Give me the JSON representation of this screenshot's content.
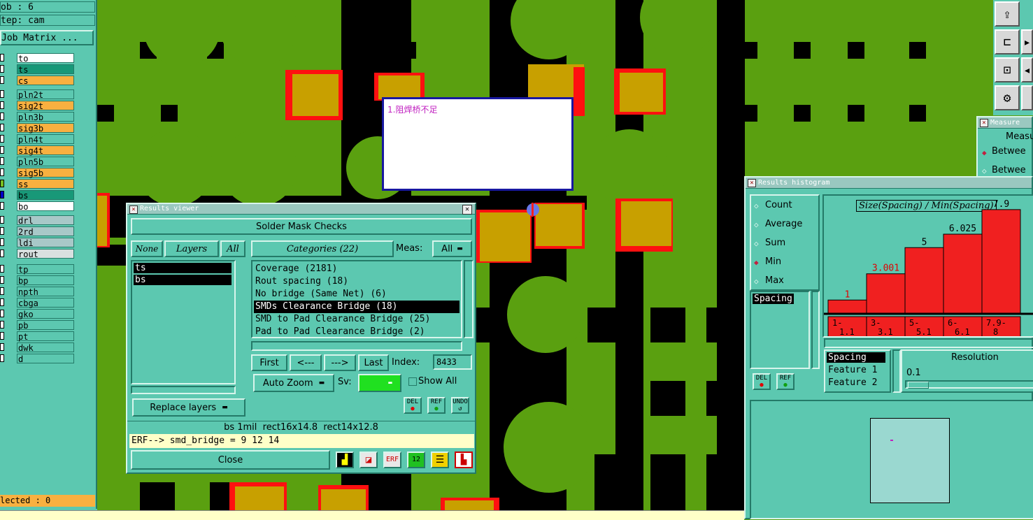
{
  "left_panel": {
    "job_label": "ob  : 6",
    "step_label": "tep: cam",
    "matrix_button": "Job Matrix ...",
    "layers": [
      {
        "name": "to",
        "color": "#ffffff",
        "sq": "#ffffff"
      },
      {
        "name": "ts",
        "color": "#189878",
        "sq": "#ffffff"
      },
      {
        "name": "cs",
        "color": "#f8b040",
        "sq": "#ffffff"
      },
      {
        "name": "pln2t",
        "color": "#5cc8b0",
        "sq": "#ffffff"
      },
      {
        "name": "sig2t",
        "color": "#f8b040",
        "sq": "#ffffff"
      },
      {
        "name": "pln3b",
        "color": "#5cc8b0",
        "sq": "#ffffff"
      },
      {
        "name": "sig3b",
        "color": "#f8b040",
        "sq": "#ffffff"
      },
      {
        "name": "pln4t",
        "color": "#5cc8b0",
        "sq": "#ffffff"
      },
      {
        "name": "sig4t",
        "color": "#f8b040",
        "sq": "#ffffff"
      },
      {
        "name": "pln5b",
        "color": "#5cc8b0",
        "sq": "#ffffff"
      },
      {
        "name": "sig5b",
        "color": "#f8b040",
        "sq": "#ffffff"
      },
      {
        "name": "ss",
        "color": "#f8b040",
        "sq": "#78c020"
      },
      {
        "name": "bs",
        "color": "#189878",
        "sq": "#0000c8"
      },
      {
        "name": "bo",
        "color": "#ffffff",
        "sq": "#ffffff"
      },
      {
        "name": "drl",
        "color": "#a8c8c8",
        "sq": "#ffffff"
      },
      {
        "name": "2rd",
        "color": "#a8c8c8",
        "sq": "#ffffff"
      },
      {
        "name": "ldi",
        "color": "#a8c8c8",
        "sq": "#ffffff"
      },
      {
        "name": "rout",
        "color": "#d8e0e0",
        "sq": "#ffffff"
      },
      {
        "name": "tp",
        "color": "#5cc8b0",
        "sq": "#ffffff"
      },
      {
        "name": "bp",
        "color": "#5cc8b0",
        "sq": "#ffffff"
      },
      {
        "name": "npth",
        "color": "#5cc8b0",
        "sq": "#ffffff"
      },
      {
        "name": "cbga",
        "color": "#5cc8b0",
        "sq": "#ffffff"
      },
      {
        "name": "gko",
        "color": "#5cc8b0",
        "sq": "#ffffff"
      },
      {
        "name": "pb",
        "color": "#5cc8b0",
        "sq": "#ffffff"
      },
      {
        "name": "pt",
        "color": "#5cc8b0",
        "sq": "#ffffff"
      },
      {
        "name": "dwk",
        "color": "#5cc8b0",
        "sq": "#ffffff"
      },
      {
        "name": "d",
        "color": "#5cc8b0",
        "sq": "#ffffff"
      }
    ],
    "selected_label": "lected : 0"
  },
  "note": {
    "text": "1.阻焊桥不足"
  },
  "results_viewer": {
    "title": "Results viewer",
    "header": "Solder Mask Checks",
    "none_btn": "None",
    "layers_btn": "Layers",
    "all_btn": "All",
    "layer_list": [
      "ts",
      "bs"
    ],
    "categories_btn": "Categories (22)",
    "meas_label": "Meas:",
    "meas_value": "All",
    "categories": [
      "Coverage (2181)",
      "Rout spacing (18)",
      "No bridge (Same Net) (6)",
      "SMDs Clearance Bridge (18)",
      "SMD to Pad Clearance Bridge (25)",
      "Pad to Pad Clearance Bridge (2)"
    ],
    "selected_category": 3,
    "first_btn": "First",
    "prev_btn": "<---",
    "next_btn": "--->",
    "last_btn": "Last",
    "index_label": "Index:",
    "index_value": "8433",
    "zoom_btn": "Auto Zoom",
    "sv_label": "Sv:",
    "show_all": "Show All",
    "replace_btn": "Replace layers",
    "del": "DEL",
    "ref": "REF",
    "undo": "UNDO",
    "status_line": "bs 1mil  rect16x14.8  rect14x12.8",
    "erf_line": "ERF--> smd_bridge = 9 12 14",
    "close_btn": "Close"
  },
  "histogram": {
    "title": "Results histogram",
    "modes": [
      "Count",
      "Average",
      "Sum",
      "Min",
      "Max"
    ],
    "selected_mode": "Min",
    "chart_title": "Size(Spacing) / Min(Spacing)",
    "list_item": "Spacing",
    "del": "DEL",
    "ref": "REF",
    "features": [
      "Spacing",
      "Feature 1",
      "Feature 2"
    ],
    "resolution_label": "Resolution",
    "resolution_value": "0.1"
  },
  "measure": {
    "title": "Measure",
    "header": "Measu",
    "option1": "Betwee",
    "option2": "Betwee"
  },
  "chart_data": {
    "type": "bar",
    "title": "Size(Spacing) / Min(Spacing)",
    "categories": [
      "1-\n1.1",
      "3-\n3.1",
      "5-\n5.1",
      "6-\n6.1",
      "7.9-\n8"
    ],
    "values": [
      1,
      3.001,
      5,
      6.025,
      7.9
    ],
    "value_labels": [
      "1",
      "3.001",
      "5",
      "6.025",
      "7.9"
    ],
    "ylim": [
      0,
      8
    ],
    "bar_color": "#f02020",
    "label_colors": [
      "#e00000",
      "#e00000",
      "#000000",
      "#000000",
      "#000000"
    ]
  },
  "colors": {
    "board": "#5aa010",
    "copper": "#000000",
    "pad": "#c8a000",
    "error": "#ff1010",
    "panel": "#5cc8b0"
  }
}
